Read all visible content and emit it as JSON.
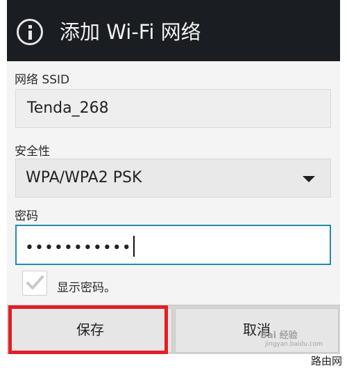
{
  "dialog": {
    "title": "添加 Wi-Fi 网络",
    "title_icon": "info-icon"
  },
  "ssid": {
    "label": "网络 SSID",
    "value": "Tenda_268"
  },
  "security": {
    "label": "安全性",
    "selected": "WPA/WPA2 PSK",
    "dropdown_icon": "triangle-down-icon"
  },
  "password": {
    "label": "密码",
    "value": "•••••••••••"
  },
  "show_password": {
    "label": "显示密码。",
    "checked": true
  },
  "buttons": {
    "save": "保存",
    "cancel": "取消"
  },
  "highlight_color": "#e31e24",
  "accent_color": "#1f8ea8",
  "watermarks": {
    "baidu": "Bai 经验",
    "baidu_sub": "jingyan.baidu.com",
    "site": "路由网"
  }
}
